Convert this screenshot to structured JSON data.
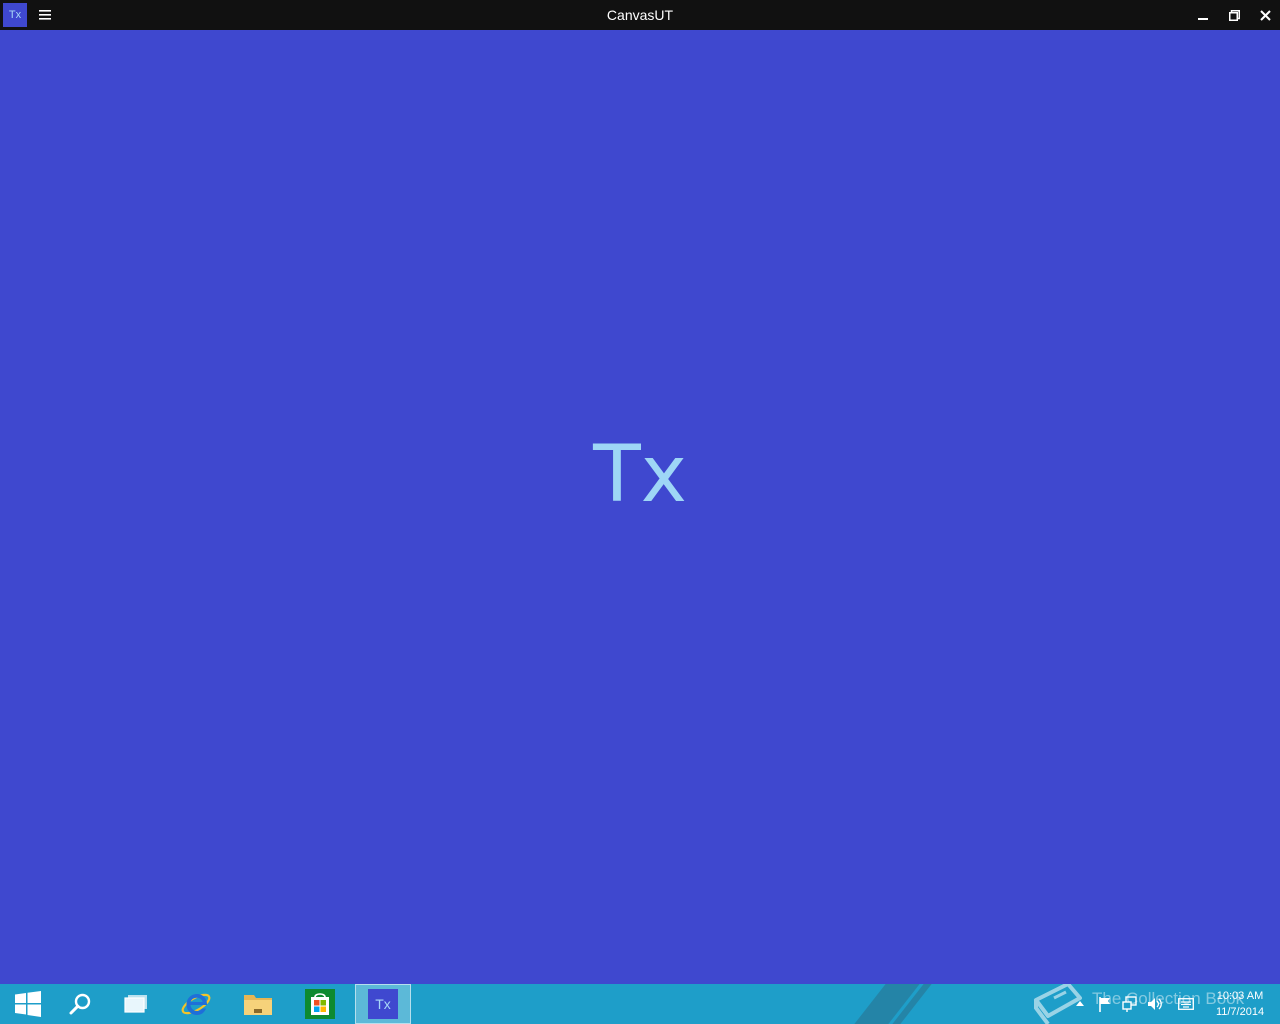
{
  "window": {
    "title": "CanvasUT",
    "app_icon_label": "Tx",
    "menu_icon": "hamburger-menu-icon",
    "controls": {
      "minimize_icon": "minimize-icon",
      "maximize_icon": "restore-icon",
      "close_icon": "close-icon"
    }
  },
  "canvas": {
    "background_color": "#3f48cf",
    "center_text": "Tx",
    "center_text_color": "#9ed6f6"
  },
  "taskbar": {
    "background_color": "#1e9ec9",
    "buttons": [
      {
        "name": "start-button",
        "icon": "windows-logo-icon"
      },
      {
        "name": "search-button",
        "icon": "search-icon"
      },
      {
        "name": "task-view-button",
        "icon": "task-view-icon"
      },
      {
        "name": "internet-explorer-button",
        "icon": "internet-explorer-icon"
      },
      {
        "name": "file-explorer-button",
        "icon": "folder-icon"
      },
      {
        "name": "store-button",
        "icon": "store-icon"
      },
      {
        "name": "canvasut-taskbar-button",
        "icon": "tx-app-icon",
        "label": "Tx",
        "active": true
      }
    ],
    "tray": {
      "watermark_text": "The Collection Book",
      "icons": [
        "show-hidden-icons-chevron-icon",
        "action-center-flag-icon",
        "network-icon",
        "volume-icon",
        "keyboard-icon"
      ],
      "clock_time": "10:03 AM",
      "clock_date": "11/7/2014"
    }
  }
}
